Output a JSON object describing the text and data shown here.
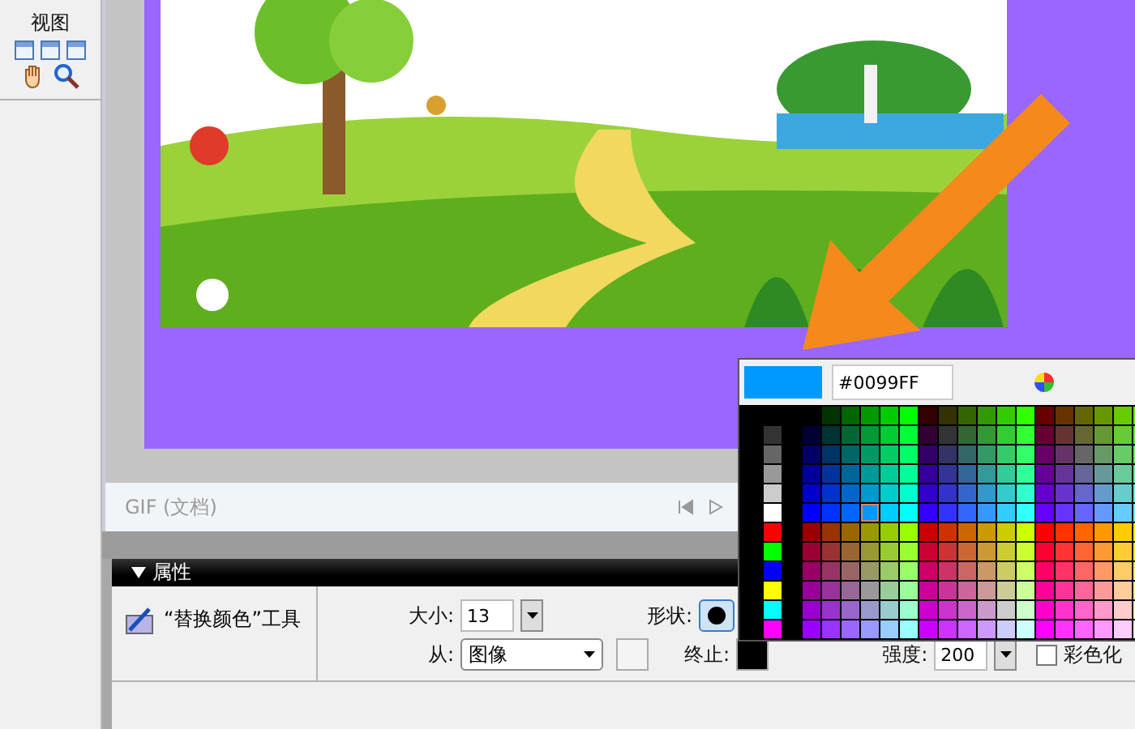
{
  "left_panel": {
    "title": "视图"
  },
  "document": {
    "status": "GIF (文档)"
  },
  "properties": {
    "title": "属性",
    "tool_name": "“替换颜色”工具",
    "size_label": "大小:",
    "size_value": "13",
    "shape_label": "形状:",
    "shapes": [
      {
        "kind": "round",
        "selected": true
      }
    ],
    "from_label": "从:",
    "from_value": "图像",
    "end_label": "终止:",
    "strength_label": "强度:",
    "strength_value": "200",
    "colorize": {
      "label": "彩色化",
      "checked": false
    }
  },
  "color_picker": {
    "value": "#0099FF"
  }
}
